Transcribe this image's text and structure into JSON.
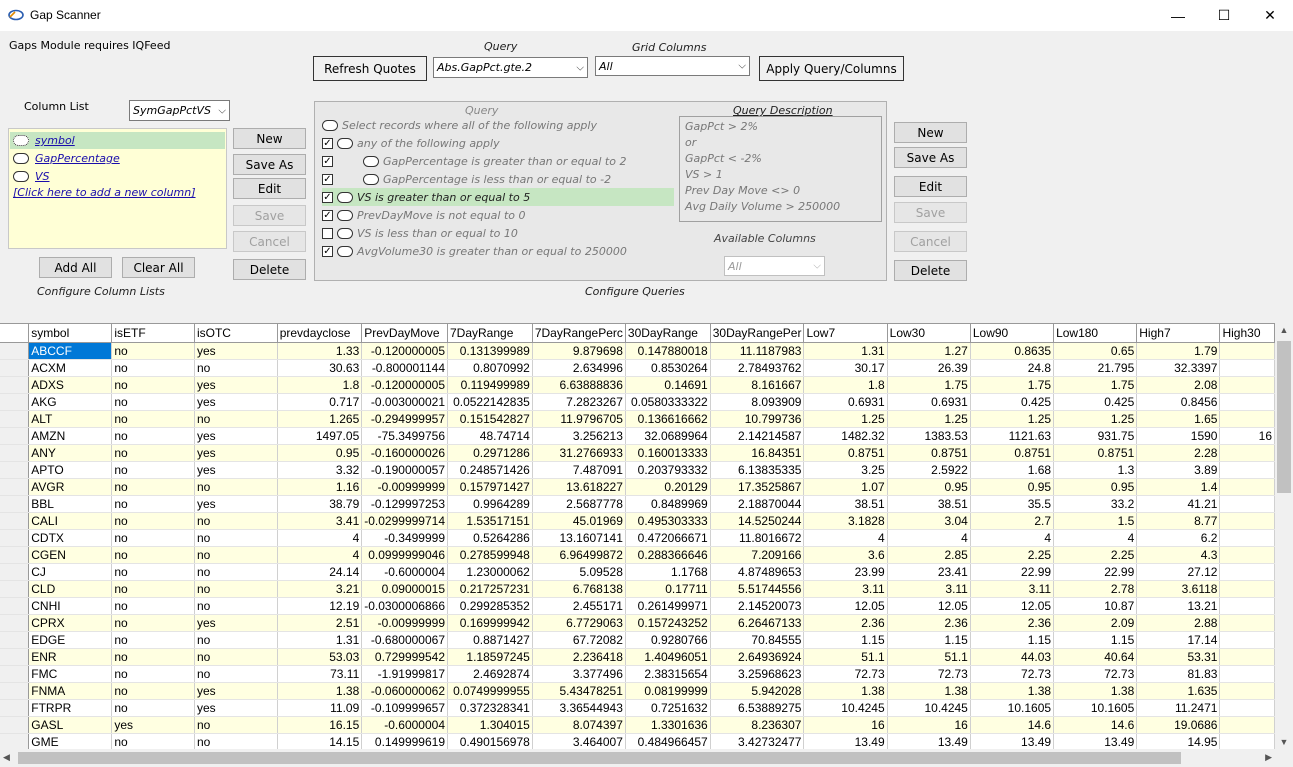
{
  "window": {
    "title": "Gap Scanner",
    "minimize": "—",
    "maximize": "☐",
    "close": "✕"
  },
  "notice": "Gaps Module requires IQFeed",
  "toolbar": {
    "refresh_label": "Refresh Quotes",
    "query_label": "Query",
    "query_value": "Abs.GapPct.gte.2",
    "grid_columns_label": "Grid Columns",
    "grid_columns_value": "All",
    "apply_label": "Apply Query/Columns"
  },
  "column_list": {
    "label": "Column List",
    "selected_list": "SymGapPctVS",
    "items": [
      "symbol",
      "GapPercentage",
      "VS"
    ],
    "add_hint": "[Click here to add a new column]",
    "buttons": {
      "new": "New",
      "save_as": "Save As",
      "edit": "Edit",
      "save": "Save",
      "cancel": "Cancel",
      "delete": "Delete"
    },
    "add_all": "Add All",
    "clear_all": "Clear All",
    "caption": "Configure Column Lists"
  },
  "query_panel": {
    "title": "Query",
    "lines": [
      "Select records where  all  of the following apply",
      "any  of the following apply",
      "GapPercentage  is greater than or equal to  2",
      "GapPercentage  is less than or equal to  -2",
      "VS  is greater than or equal to  5",
      "PrevDayMove  is not equal to  0",
      "VS  is less than or equal to  10",
      "AvgVolume30  is greater than or equal to  250000"
    ],
    "description_title": "Query Description",
    "description": [
      "GapPct > 2%",
      "or",
      "GapPct < -2%",
      "VS > 1",
      "Prev Day Move <> 0",
      "Avg Daily Volume > 250000"
    ],
    "available_columns_label": "Available Columns",
    "available_columns_value": "All",
    "buttons": {
      "new": "New",
      "save_as": "Save As",
      "edit": "Edit",
      "save": "Save",
      "cancel": "Cancel",
      "delete": "Delete"
    },
    "caption": "Configure Queries"
  },
  "grid": {
    "columns": [
      "symbol",
      "isETF",
      "isOTC",
      "prevdayclose",
      "PrevDayMove",
      "7DayRange",
      "7DayRangePerc",
      "30DayRange",
      "30DayRangePer",
      "Low7",
      "Low30",
      "Low90",
      "Low180",
      "High7",
      "High30"
    ],
    "rows": [
      [
        "ABCCF",
        "no",
        "yes",
        "1.33",
        "-0.120000005",
        "0.131399989",
        "9.879698",
        "0.147880018",
        "11.1187983",
        "1.31",
        "1.27",
        "0.8635",
        "0.65",
        "1.79",
        ""
      ],
      [
        "ACXM",
        "no",
        "no",
        "30.63",
        "-0.800001144",
        "0.8070992",
        "2.634996",
        "0.8530264",
        "2.78493762",
        "30.17",
        "26.39",
        "24.8",
        "21.795",
        "32.3397",
        ""
      ],
      [
        "ADXS",
        "no",
        "yes",
        "1.8",
        "-0.120000005",
        "0.119499989",
        "6.63888836",
        "0.14691",
        "8.161667",
        "1.8",
        "1.75",
        "1.75",
        "1.75",
        "2.08",
        ""
      ],
      [
        "AKG",
        "no",
        "yes",
        "0.717",
        "-0.003000021",
        "0.0522142835",
        "7.2823267",
        "0.0580333322",
        "8.093909",
        "0.6931",
        "0.6931",
        "0.425",
        "0.425",
        "0.8456",
        ""
      ],
      [
        "ALT",
        "no",
        "no",
        "1.265",
        "-0.294999957",
        "0.151542827",
        "11.9796705",
        "0.136616662",
        "10.799736",
        "1.25",
        "1.25",
        "1.25",
        "1.25",
        "1.65",
        ""
      ],
      [
        "AMZN",
        "no",
        "yes",
        "1497.05",
        "-75.3499756",
        "48.74714",
        "3.256213",
        "32.0689964",
        "2.14214587",
        "1482.32",
        "1383.53",
        "1121.63",
        "931.75",
        "1590",
        "16"
      ],
      [
        "ANY",
        "no",
        "yes",
        "0.95",
        "-0.160000026",
        "0.2971286",
        "31.2766933",
        "0.160013333",
        "16.84351",
        "0.8751",
        "0.8751",
        "0.8751",
        "0.8751",
        "2.28",
        ""
      ],
      [
        "APTO",
        "no",
        "yes",
        "3.32",
        "-0.190000057",
        "0.248571426",
        "7.487091",
        "0.203793332",
        "6.13835335",
        "3.25",
        "2.5922",
        "1.68",
        "1.3",
        "3.89",
        ""
      ],
      [
        "AVGR",
        "no",
        "no",
        "1.16",
        "-0.00999999",
        "0.157971427",
        "13.618227",
        "0.20129",
        "17.3525867",
        "1.07",
        "0.95",
        "0.95",
        "0.95",
        "1.4",
        ""
      ],
      [
        "BBL",
        "no",
        "yes",
        "38.79",
        "-0.129997253",
        "0.9964289",
        "2.5687778",
        "0.8489969",
        "2.18870044",
        "38.51",
        "38.51",
        "35.5",
        "33.2",
        "41.21",
        ""
      ],
      [
        "CALI",
        "no",
        "no",
        "3.41",
        "-0.0299999714",
        "1.53517151",
        "45.01969",
        "0.495303333",
        "14.5250244",
        "3.1828",
        "3.04",
        "2.7",
        "1.5",
        "8.77",
        ""
      ],
      [
        "CDTX",
        "no",
        "no",
        "4",
        "-0.3499999",
        "0.5264286",
        "13.1607141",
        "0.472066671",
        "11.8016672",
        "4",
        "4",
        "4",
        "4",
        "6.2",
        ""
      ],
      [
        "CGEN",
        "no",
        "no",
        "4",
        "0.0999999046",
        "0.278599948",
        "6.96499872",
        "0.288366646",
        "7.209166",
        "3.6",
        "2.85",
        "2.25",
        "2.25",
        "4.3",
        ""
      ],
      [
        "CJ",
        "no",
        "no",
        "24.14",
        "-0.6000004",
        "1.23000062",
        "5.09528",
        "1.1768",
        "4.87489653",
        "23.99",
        "23.41",
        "22.99",
        "22.99",
        "27.12",
        ""
      ],
      [
        "CLD",
        "no",
        "no",
        "3.21",
        "0.09000015",
        "0.217257231",
        "6.768138",
        "0.17711",
        "5.51744556",
        "3.11",
        "3.11",
        "3.11",
        "2.78",
        "3.6118",
        ""
      ],
      [
        "CNHI",
        "no",
        "no",
        "12.19",
        "-0.0300006866",
        "0.299285352",
        "2.455171",
        "0.261499971",
        "2.14520073",
        "12.05",
        "12.05",
        "12.05",
        "10.87",
        "13.21",
        ""
      ],
      [
        "CPRX",
        "no",
        "yes",
        "2.51",
        "-0.00999999",
        "0.169999942",
        "6.7729063",
        "0.157243252",
        "6.26467133",
        "2.36",
        "2.36",
        "2.36",
        "2.09",
        "2.88",
        ""
      ],
      [
        "EDGE",
        "no",
        "no",
        "1.31",
        "-0.680000067",
        "0.8871427",
        "67.72082",
        "0.9280766",
        "70.84555",
        "1.15",
        "1.15",
        "1.15",
        "1.15",
        "17.14",
        ""
      ],
      [
        "ENR",
        "no",
        "no",
        "53.03",
        "0.729999542",
        "1.18597245",
        "2.236418",
        "1.40496051",
        "2.64936924",
        "51.1",
        "51.1",
        "44.03",
        "40.64",
        "53.31",
        ""
      ],
      [
        "FMC",
        "no",
        "no",
        "73.11",
        "-1.91999817",
        "2.4692874",
        "3.377496",
        "2.38315654",
        "3.25968623",
        "72.73",
        "72.73",
        "72.73",
        "72.73",
        "81.83",
        ""
      ],
      [
        "FNMA",
        "no",
        "yes",
        "1.38",
        "-0.060000062",
        "0.0749999955",
        "5.43478251",
        "0.08199999",
        "5.942028",
        "1.38",
        "1.38",
        "1.38",
        "1.38",
        "1.635",
        ""
      ],
      [
        "FTRPR",
        "no",
        "yes",
        "11.09",
        "-0.109999657",
        "0.372328341",
        "3.36544943",
        "0.7251632",
        "6.53889275",
        "10.4245",
        "10.4245",
        "10.1605",
        "10.1605",
        "11.2471",
        ""
      ],
      [
        "GASL",
        "yes",
        "no",
        "16.15",
        "-0.6000004",
        "1.304015",
        "8.074397",
        "1.3301636",
        "8.236307",
        "16",
        "16",
        "14.6",
        "14.6",
        "19.0686",
        ""
      ],
      [
        "GME",
        "no",
        "no",
        "14.15",
        "0.149999619",
        "0.490156978",
        "3.464007",
        "0.484966457",
        "3.42732477",
        "13.49",
        "13.49",
        "13.49",
        "13.49",
        "14.95",
        ""
      ]
    ]
  }
}
